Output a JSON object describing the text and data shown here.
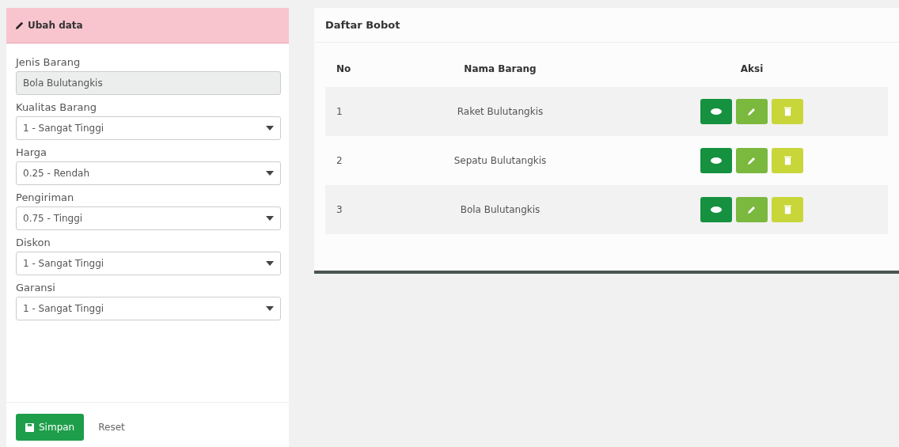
{
  "form": {
    "title": "Ubah data",
    "fields": [
      {
        "kind": "input",
        "label": "Jenis Barang",
        "value": "Bola Bulutangkis"
      },
      {
        "kind": "select",
        "label": "Kualitas Barang",
        "value": "1 - Sangat Tinggi"
      },
      {
        "kind": "select",
        "label": "Harga",
        "value": "0.25 - Rendah"
      },
      {
        "kind": "select",
        "label": "Pengiriman",
        "value": "0.75 - Tinggi"
      },
      {
        "kind": "select",
        "label": "Diskon",
        "value": "1 - Sangat Tinggi"
      },
      {
        "kind": "select",
        "label": "Garansi",
        "value": "1 - Sangat Tinggi"
      }
    ],
    "save_button": "Simpan",
    "reset_link": "Reset"
  },
  "list": {
    "title": "Daftar Bobot",
    "columns": [
      "No",
      "Nama Barang",
      "Aksi"
    ],
    "rows": [
      {
        "no": "1",
        "name": "Raket Bulutangkis"
      },
      {
        "no": "2",
        "name": "Sepatu Bulutangkis"
      },
      {
        "no": "3",
        "name": "Bola Bulutangkis"
      }
    ]
  }
}
